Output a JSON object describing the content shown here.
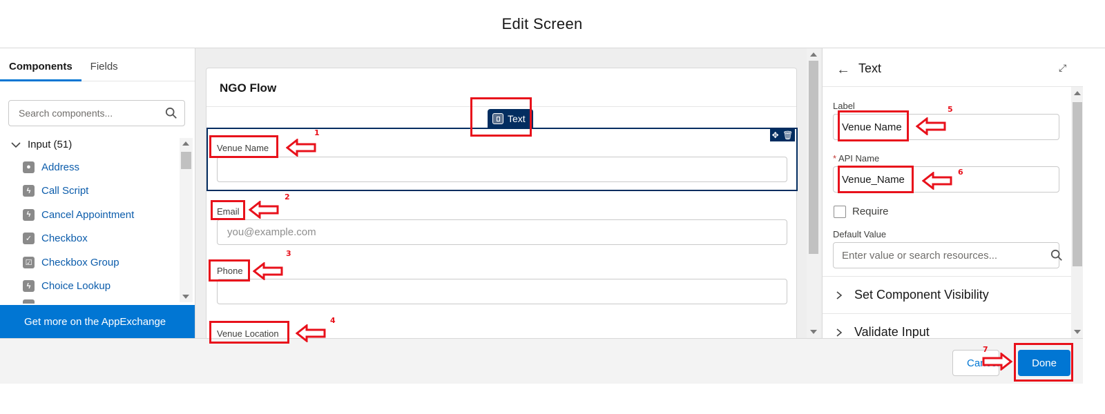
{
  "header": {
    "title": "Edit Screen"
  },
  "left_panel": {
    "tabs": [
      {
        "label": "Components",
        "active": true
      },
      {
        "label": "Fields",
        "active": false
      }
    ],
    "search": {
      "placeholder": "Search components..."
    },
    "group": {
      "label": "Input (51)"
    },
    "items": [
      {
        "label": "Address",
        "icon": "location-icon"
      },
      {
        "label": "Call Script",
        "icon": "lightning-icon"
      },
      {
        "label": "Cancel Appointment",
        "icon": "lightning-icon"
      },
      {
        "label": "Checkbox",
        "icon": "checkbox-icon"
      },
      {
        "label": "Checkbox Group",
        "icon": "checkbox-group-icon"
      },
      {
        "label": "Choice Lookup",
        "icon": "lightning-icon"
      }
    ],
    "appexchange_label": "Get more on the AppExchange"
  },
  "canvas": {
    "card_title": "NGO Flow",
    "badge_label": "Text",
    "fields": [
      {
        "label": "Venue Name",
        "value": "",
        "placeholder": ""
      },
      {
        "label": "Email",
        "value": "",
        "placeholder": "you@example.com"
      },
      {
        "label": "Phone",
        "value": "",
        "placeholder": ""
      },
      {
        "label": "Venue Location"
      }
    ]
  },
  "right_panel": {
    "title": "Text",
    "label_field": {
      "label": "Label",
      "value": "Venue Name"
    },
    "api_field": {
      "required_mark": "*",
      "label": "API Name",
      "value": "Venue_Name"
    },
    "require_label": "Require",
    "require_checked": false,
    "default_value": {
      "label": "Default Value",
      "placeholder": "Enter value or search resources..."
    },
    "sections": [
      "Set Component Visibility",
      "Validate Input"
    ]
  },
  "footer": {
    "cancel_label": "Cancel",
    "done_label": "Done"
  },
  "annotations": [
    "1",
    "2",
    "3",
    "4",
    "5",
    "6",
    "7"
  ],
  "colors": {
    "brand": "#0176d3",
    "selected": "#032d60",
    "annotation": "#e8111b"
  }
}
